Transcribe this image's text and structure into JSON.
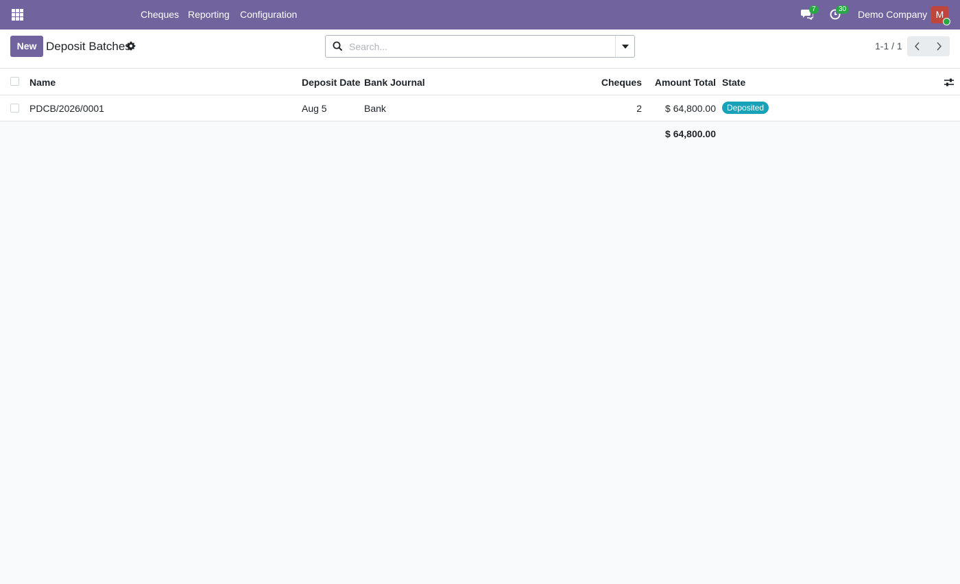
{
  "navbar": {
    "menus": [
      "Cheques",
      "Reporting",
      "Configuration"
    ],
    "messages_count": "7",
    "activities_count": "30",
    "company": "Demo Company",
    "avatar_initial": "M",
    "color": "#71639e"
  },
  "control_panel": {
    "new_label": "New",
    "title": "Deposit Batches",
    "search_placeholder": "Search...",
    "pager": "1-1 / 1"
  },
  "table": {
    "columns": {
      "name": "Name",
      "deposit_date": "Deposit Date",
      "bank_journal": "Bank Journal",
      "cheques": "Cheques",
      "amount_total": "Amount Total",
      "state": "State"
    },
    "rows": [
      {
        "name": "PDCB/2026/0001",
        "deposit_date": "Aug 5",
        "bank_journal": "Bank",
        "cheques": "2",
        "amount_total": "$ 64,800.00",
        "state": "Deposited"
      }
    ],
    "footer_total": "$ 64,800.00"
  },
  "colors": {
    "primary": "#71639e",
    "state_deposited": "#17a2b8",
    "badge_green": "#28a745",
    "avatar": "#c0453c"
  }
}
